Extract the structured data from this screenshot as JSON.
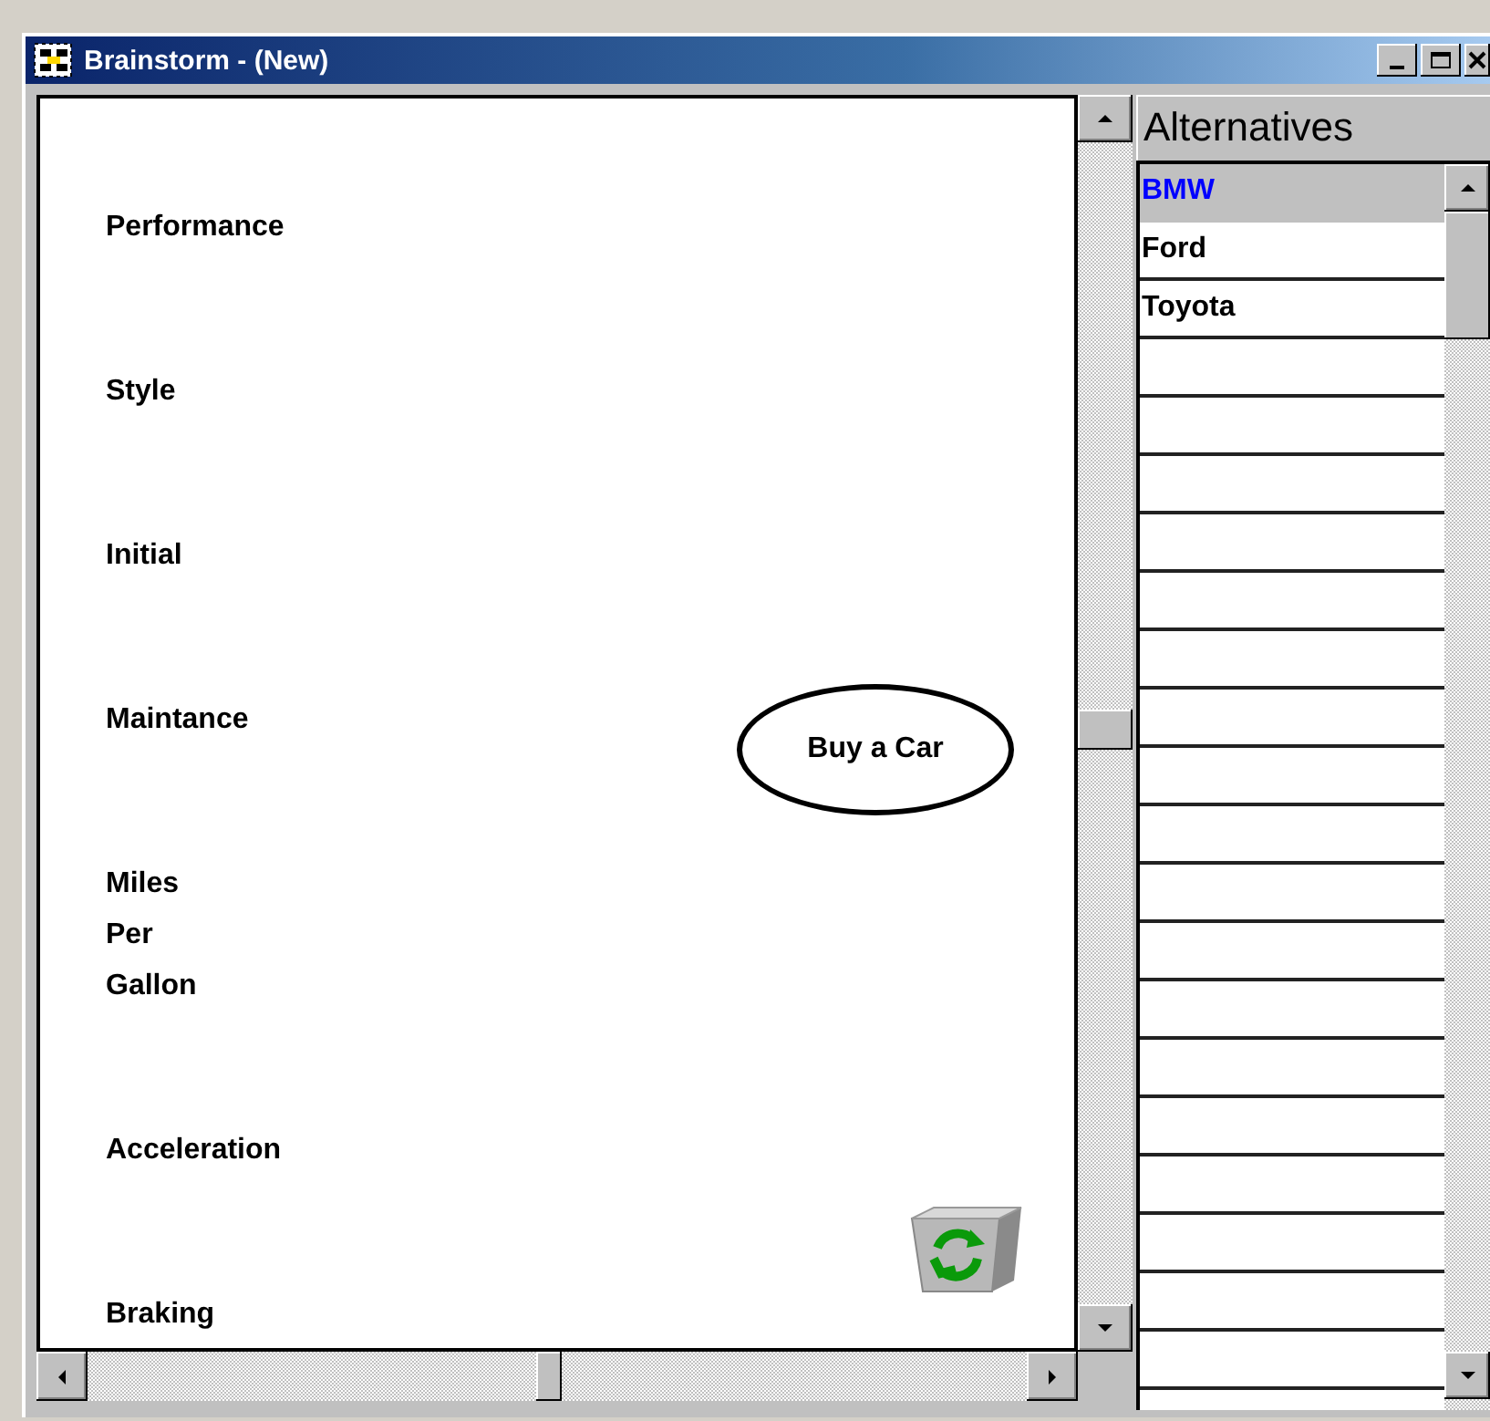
{
  "window": {
    "title": "Brainstorm - (New)"
  },
  "canvas": {
    "nodes": [
      {
        "label": "Performance",
        "kind": "criterion"
      },
      {
        "label": "Style",
        "kind": "criterion"
      },
      {
        "label": "Initial",
        "kind": "criterion"
      },
      {
        "label": "Maintance",
        "kind": "criterion"
      },
      {
        "label": "Miles\nPer\nGallon",
        "kind": "criterion"
      },
      {
        "label": "Acceleration",
        "kind": "criterion"
      },
      {
        "label": "Braking",
        "kind": "criterion"
      },
      {
        "label": "Buy a Car",
        "kind": "goal"
      }
    ]
  },
  "alternatives": {
    "title": "Alternatives",
    "items": [
      {
        "label": "BMW",
        "selected": true
      },
      {
        "label": "Ford",
        "selected": false
      },
      {
        "label": "Toyota",
        "selected": false
      }
    ]
  }
}
